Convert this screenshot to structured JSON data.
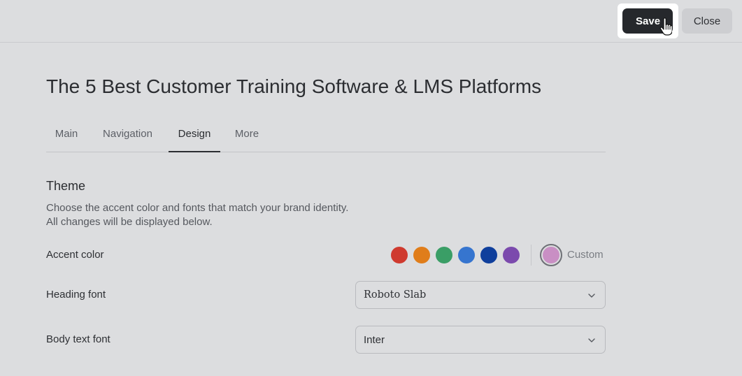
{
  "toolbar": {
    "save_label": "Save",
    "close_label": "Close"
  },
  "page": {
    "title": "The 5 Best Customer Training Software & LMS Platforms"
  },
  "tabs": [
    {
      "label": "Main",
      "active": false
    },
    {
      "label": "Navigation",
      "active": false
    },
    {
      "label": "Design",
      "active": true
    },
    {
      "label": "More",
      "active": false
    }
  ],
  "theme": {
    "title": "Theme",
    "description_line1": "Choose the accent color and fonts that match your brand identity.",
    "description_line2": "All changes will be displayed below.",
    "accent_label": "Accent color",
    "accent_colors": [
      "#cf3a2f",
      "#e07d1a",
      "#3a9e66",
      "#3675cf",
      "#0f3f9c",
      "#7b4aad"
    ],
    "custom_color": "#c98fc4",
    "custom_label": "Custom",
    "heading_font_label": "Heading font",
    "heading_font_value": "Roboto Slab",
    "body_font_label": "Body text font",
    "body_font_value": "Inter"
  }
}
